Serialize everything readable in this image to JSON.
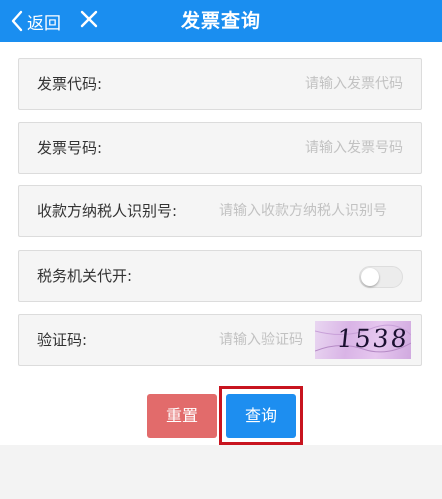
{
  "header": {
    "back_label": "返回",
    "title": "发票查询"
  },
  "form": {
    "invoice_code": {
      "label": "发票代码:",
      "placeholder": "请输入发票代码",
      "value": ""
    },
    "invoice_number": {
      "label": "发票号码:",
      "placeholder": "请输入发票号码",
      "value": ""
    },
    "payee_tax_id": {
      "label": "收款方纳税人识别号:",
      "placeholder": "请输入收款方纳税人识别号",
      "value": ""
    },
    "tax_office_issued": {
      "label": "税务机关代开:",
      "enabled": false
    },
    "captcha": {
      "label": "验证码:",
      "placeholder": "请输入验证码",
      "value": "",
      "image_text": "1538"
    }
  },
  "actions": {
    "reset_label": "重置",
    "query_label": "查询"
  },
  "colors": {
    "header_bg": "#1a8ef0",
    "reset_bg": "#e26b6b",
    "query_bg": "#1d8ef0",
    "highlight": "#c8141f"
  }
}
